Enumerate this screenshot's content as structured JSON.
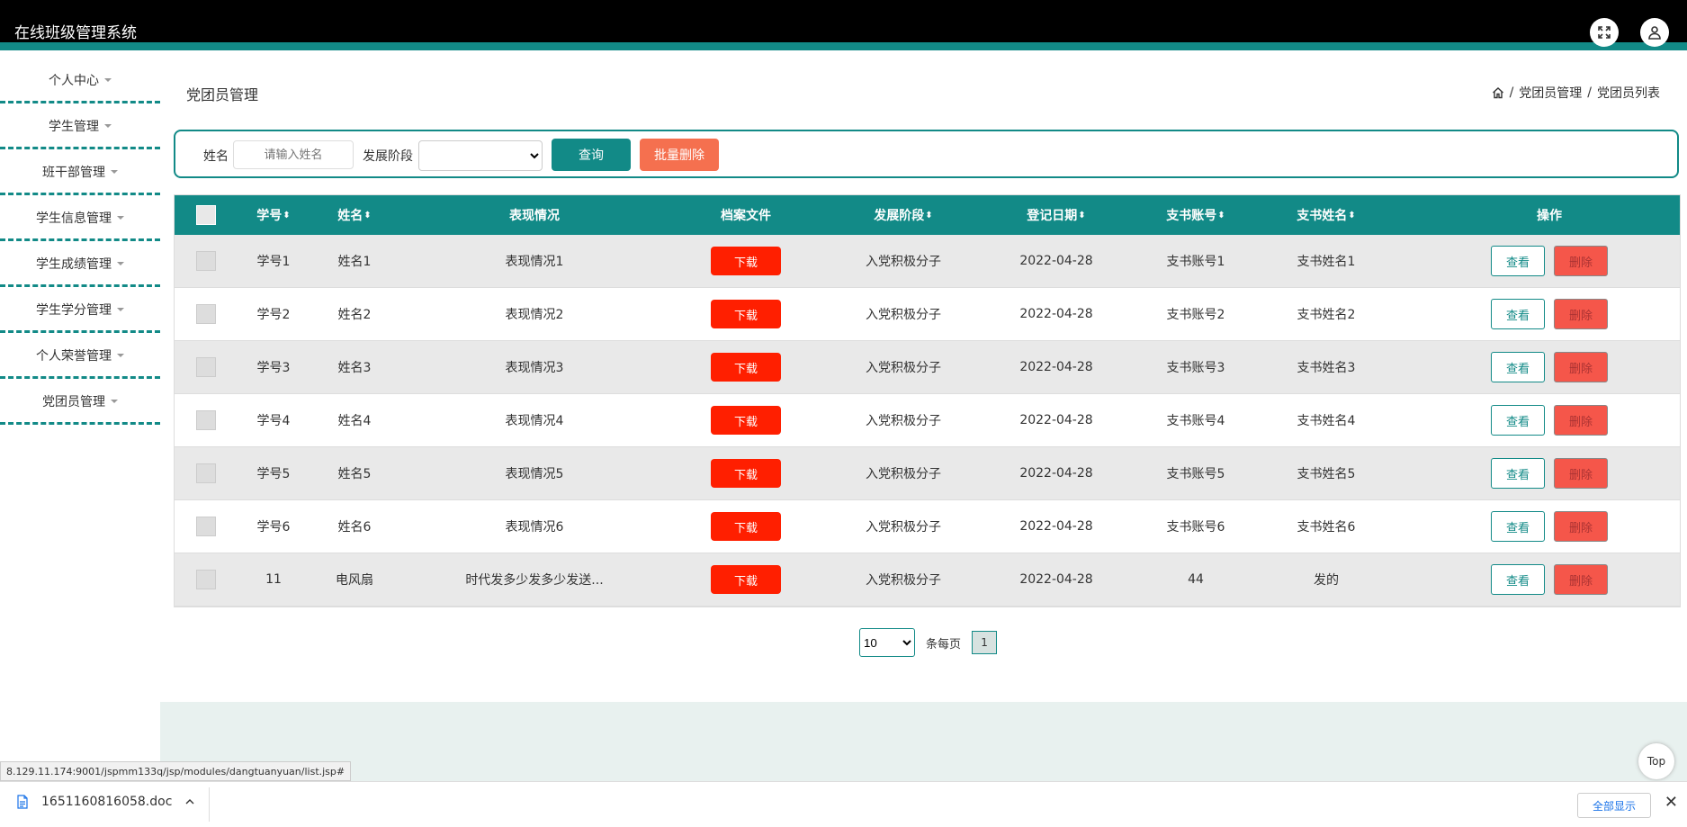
{
  "app": {
    "title": "在线班级管理系统"
  },
  "header_icons": [
    "fullscreen-icon",
    "user-icon"
  ],
  "sidebar": {
    "items": [
      {
        "label": "个人中心"
      },
      {
        "label": "学生管理"
      },
      {
        "label": "班干部管理"
      },
      {
        "label": "学生信息管理"
      },
      {
        "label": "学生成绩管理"
      },
      {
        "label": "学生学分管理"
      },
      {
        "label": "个人荣誉管理"
      },
      {
        "label": "党团员管理"
      }
    ]
  },
  "page": {
    "title": "党团员管理",
    "breadcrumb": [
      "党团员管理",
      "党团员列表"
    ],
    "breadcrumb_sep": "/"
  },
  "search": {
    "name_label": "姓名",
    "name_placeholder": "请输入姓名",
    "stage_label": "发展阶段",
    "stage_value": "",
    "query_btn": "查询",
    "batch_delete_btn": "批量删除"
  },
  "table": {
    "headers": {
      "xuehao": "学号",
      "xingming": "姓名",
      "biaoxian": "表现情况",
      "dangan": "档案文件",
      "jieduan": "发展阶段",
      "riqi": "登记日期",
      "zhanghao": "支书账号",
      "zhishu": "支书姓名",
      "caozuo": "操作"
    },
    "sort_glyph": "⬍",
    "rows": [
      {
        "xuehao": "学号1",
        "xingming": "姓名1",
        "biaoxian": "表现情况1",
        "download": "下载",
        "jieduan": "入党积极分子",
        "riqi": "2022-04-28",
        "zhanghao": "支书账号1",
        "zhishu": "支书姓名1",
        "view": "查看",
        "del": "删除"
      },
      {
        "xuehao": "学号2",
        "xingming": "姓名2",
        "biaoxian": "表现情况2",
        "download": "下载",
        "jieduan": "入党积极分子",
        "riqi": "2022-04-28",
        "zhanghao": "支书账号2",
        "zhishu": "支书姓名2",
        "view": "查看",
        "del": "删除"
      },
      {
        "xuehao": "学号3",
        "xingming": "姓名3",
        "biaoxian": "表现情况3",
        "download": "下载",
        "jieduan": "入党积极分子",
        "riqi": "2022-04-28",
        "zhanghao": "支书账号3",
        "zhishu": "支书姓名3",
        "view": "查看",
        "del": "删除"
      },
      {
        "xuehao": "学号4",
        "xingming": "姓名4",
        "biaoxian": "表现情况4",
        "download": "下载",
        "jieduan": "入党积极分子",
        "riqi": "2022-04-28",
        "zhanghao": "支书账号4",
        "zhishu": "支书姓名4",
        "view": "查看",
        "del": "删除"
      },
      {
        "xuehao": "学号5",
        "xingming": "姓名5",
        "biaoxian": "表现情况5",
        "download": "下载",
        "jieduan": "入党积极分子",
        "riqi": "2022-04-28",
        "zhanghao": "支书账号5",
        "zhishu": "支书姓名5",
        "view": "查看",
        "del": "删除"
      },
      {
        "xuehao": "学号6",
        "xingming": "姓名6",
        "biaoxian": "表现情况6",
        "download": "下载",
        "jieduan": "入党积极分子",
        "riqi": "2022-04-28",
        "zhanghao": "支书账号6",
        "zhishu": "支书姓名6",
        "view": "查看",
        "del": "删除"
      },
      {
        "xuehao": "11",
        "xingming": "电风扇",
        "biaoxian": "时代发多少发多少发送...",
        "download": "下载",
        "jieduan": "入党积极分子",
        "riqi": "2022-04-28",
        "zhanghao": "44",
        "zhishu": "发的",
        "view": "查看",
        "del": "删除"
      }
    ]
  },
  "pagination": {
    "page_size": "10",
    "per_page_label": "条每页",
    "current_page": "1"
  },
  "status_url": "8.129.11.174:9001/jspmm133q/jsp/modules/dangtuanyuan/list.jsp#",
  "top_btn": "Top",
  "downloads_bar": {
    "file_name": "1651160816058.doc",
    "show_all": "全部显示",
    "close": "✕"
  },
  "colors": {
    "accent": "#128a87",
    "danger": "#ff1f00",
    "batch": "#f5704f",
    "delete": "#f5564a"
  }
}
